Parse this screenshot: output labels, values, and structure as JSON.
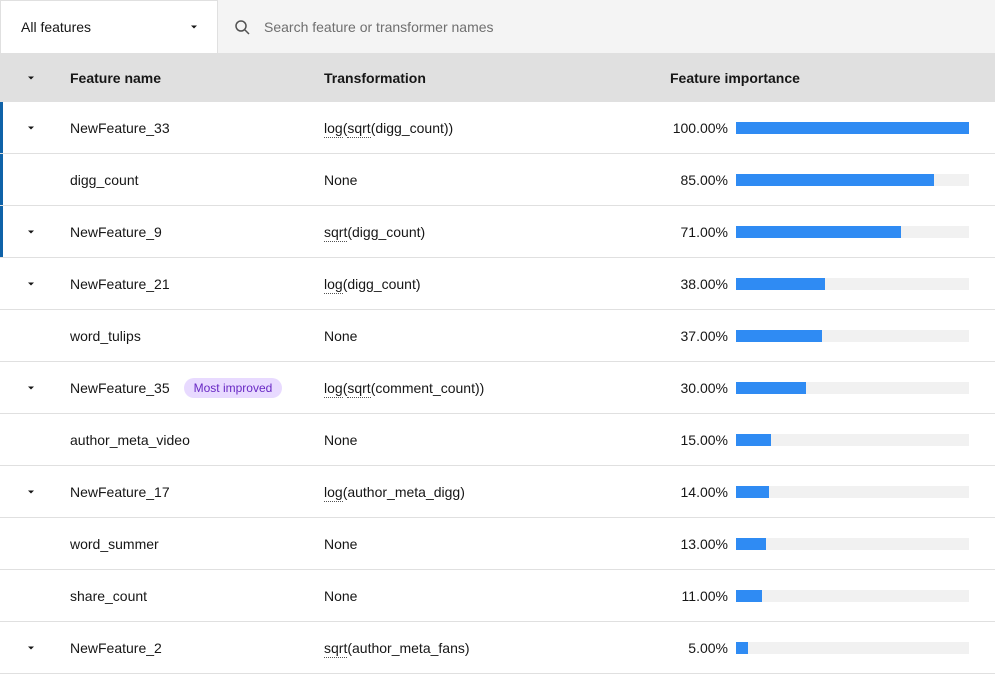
{
  "filter": {
    "label": "All features"
  },
  "search": {
    "placeholder": "Search feature or transformer names"
  },
  "columns": {
    "name": "Feature name",
    "transformation": "Transformation",
    "importance": "Feature importance"
  },
  "badges": {
    "most_improved": "Most improved"
  },
  "rows": [
    {
      "expandable": true,
      "highlighted": true,
      "name": "NewFeature_33",
      "transformation": [
        {
          "t": "log",
          "d": true
        },
        {
          "t": "(",
          "d": false
        },
        {
          "t": "sqrt",
          "d": true
        },
        {
          "t": "(digg_count))",
          "d": false
        }
      ],
      "importance_pct": "100.00%",
      "importance_val": 100
    },
    {
      "expandable": false,
      "highlighted": true,
      "name": "digg_count",
      "transformation": [
        {
          "t": "None",
          "d": false
        }
      ],
      "importance_pct": "85.00%",
      "importance_val": 85
    },
    {
      "expandable": true,
      "highlighted": true,
      "name": "NewFeature_9",
      "transformation": [
        {
          "t": "sqrt",
          "d": true
        },
        {
          "t": "(digg_count)",
          "d": false
        }
      ],
      "importance_pct": "71.00%",
      "importance_val": 71
    },
    {
      "expandable": true,
      "highlighted": false,
      "name": "NewFeature_21",
      "transformation": [
        {
          "t": "log",
          "d": true
        },
        {
          "t": "(digg_count)",
          "d": false
        }
      ],
      "importance_pct": "38.00%",
      "importance_val": 38
    },
    {
      "expandable": false,
      "highlighted": false,
      "name": "word_tulips",
      "transformation": [
        {
          "t": "None",
          "d": false
        }
      ],
      "importance_pct": "37.00%",
      "importance_val": 37
    },
    {
      "expandable": true,
      "highlighted": false,
      "name": "NewFeature_35",
      "badge": "most_improved",
      "transformation": [
        {
          "t": "log",
          "d": true
        },
        {
          "t": "(",
          "d": false
        },
        {
          "t": "sqrt",
          "d": true
        },
        {
          "t": "(comment_count))",
          "d": false
        }
      ],
      "importance_pct": "30.00%",
      "importance_val": 30
    },
    {
      "expandable": false,
      "highlighted": false,
      "name": "author_meta_video",
      "transformation": [
        {
          "t": "None",
          "d": false
        }
      ],
      "importance_pct": "15.00%",
      "importance_val": 15
    },
    {
      "expandable": true,
      "highlighted": false,
      "name": "NewFeature_17",
      "transformation": [
        {
          "t": "log",
          "d": true
        },
        {
          "t": "(author_meta_digg)",
          "d": false
        }
      ],
      "importance_pct": "14.00%",
      "importance_val": 14
    },
    {
      "expandable": false,
      "highlighted": false,
      "name": "word_summer",
      "transformation": [
        {
          "t": "None",
          "d": false
        }
      ],
      "importance_pct": "13.00%",
      "importance_val": 13
    },
    {
      "expandable": false,
      "highlighted": false,
      "name": "share_count",
      "transformation": [
        {
          "t": "None",
          "d": false
        }
      ],
      "importance_pct": "11.00%",
      "importance_val": 11
    },
    {
      "expandable": true,
      "highlighted": false,
      "name": "NewFeature_2",
      "transformation": [
        {
          "t": "sqrt",
          "d": true
        },
        {
          "t": "(author_meta_fans)",
          "d": false
        }
      ],
      "importance_pct": "5.00%",
      "importance_val": 5
    }
  ]
}
